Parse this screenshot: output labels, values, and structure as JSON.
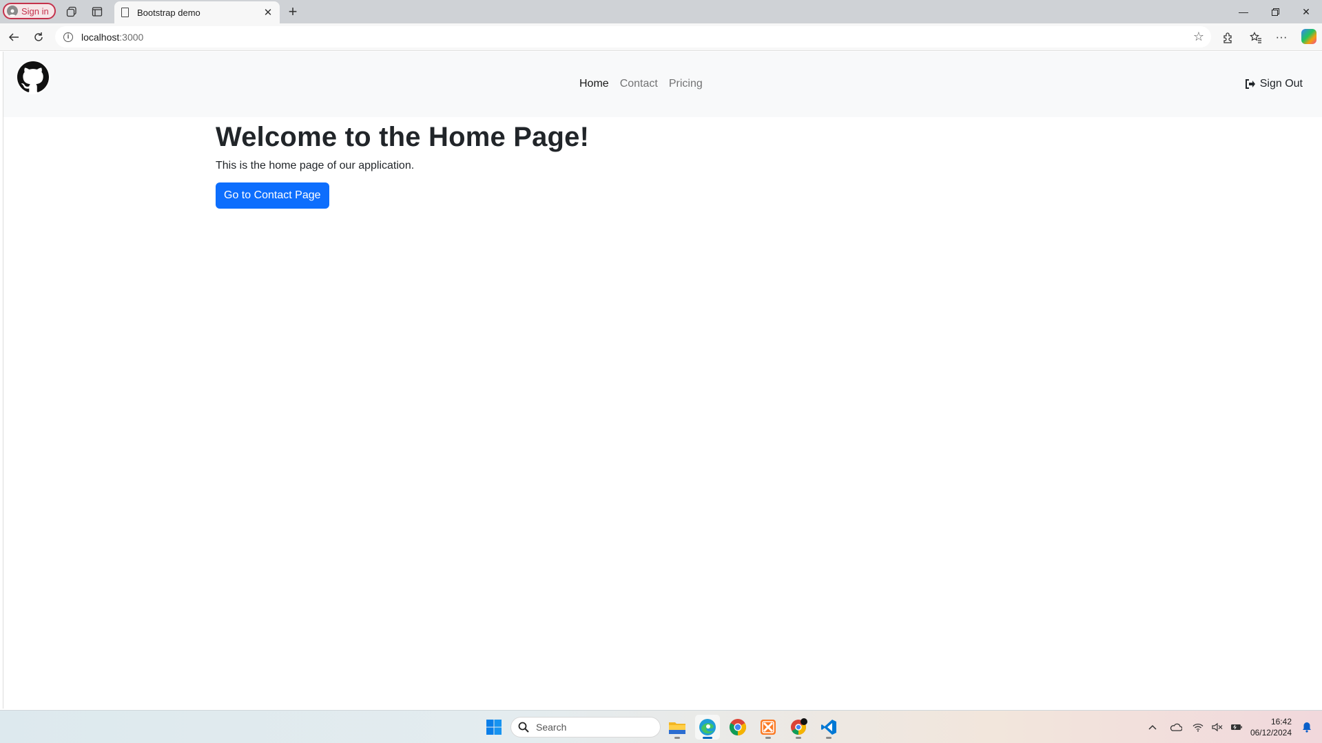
{
  "browser": {
    "signin_label": "Sign in",
    "tab_title": "Bootstrap demo",
    "address_host": "localhost",
    "address_port": ":3000",
    "window_controls": [
      "minimize-icon",
      "restore-icon",
      "close-icon"
    ]
  },
  "navbar": {
    "logo": "github-icon",
    "links": [
      {
        "label": "Home",
        "active": true
      },
      {
        "label": "Contact",
        "active": false
      },
      {
        "label": "Pricing",
        "active": false
      }
    ],
    "signout_label": "Sign Out"
  },
  "main": {
    "heading": "Welcome to the Home Page!",
    "subtitle": "This is the home page of our application.",
    "cta_label": "Go to Contact Page",
    "cta_color": "#0d6efd"
  },
  "taskbar": {
    "search_placeholder": "Search",
    "apps": [
      "windows-start-icon",
      "file-explorer-icon",
      "edge-icon",
      "chrome-icon",
      "xampp-icon",
      "chrome-profile-icon",
      "vscode-icon"
    ],
    "time": "16:42",
    "date": "06/12/2024"
  }
}
